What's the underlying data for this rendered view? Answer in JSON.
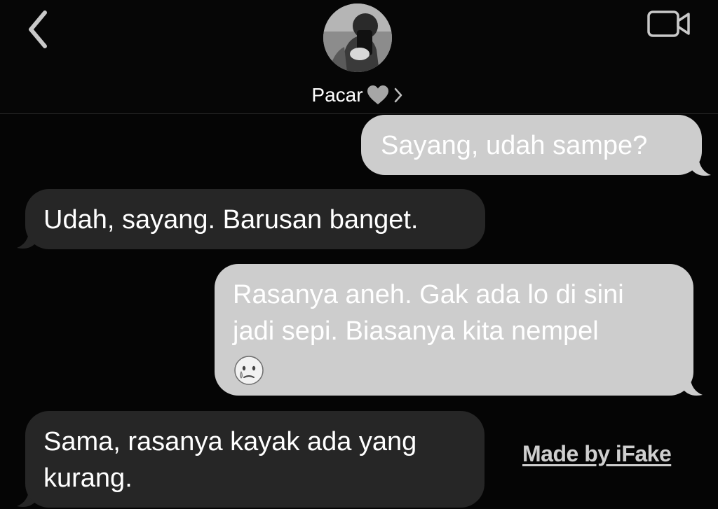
{
  "header": {
    "contact_name": "Pacar",
    "back_icon": "chevron-left-icon",
    "video_icon": "video-camera-icon",
    "heart_icon": "grey-heart-icon",
    "disclosure_icon": "chevron-right-icon"
  },
  "messages": [
    {
      "direction": "sent",
      "lines": [
        "Sayang, udah sampe?"
      ]
    },
    {
      "direction": "received",
      "lines": [
        "Udah, sayang. Barusan banget."
      ]
    },
    {
      "direction": "sent",
      "lines": [
        "Rasanya aneh. Gak ada lo di sini",
        "jadi sepi. Biasanya kita nempel"
      ],
      "emoji": "sad-face-with-tear-icon"
    },
    {
      "direction": "received",
      "lines": [
        "Sama, rasanya kayak ada yang",
        "kurang."
      ]
    }
  ],
  "watermark": "Made by iFake",
  "colors": {
    "background": "#050505",
    "sent_bubble": "#cdcdcd",
    "received_bubble": "#262626",
    "text": "#ffffff"
  }
}
